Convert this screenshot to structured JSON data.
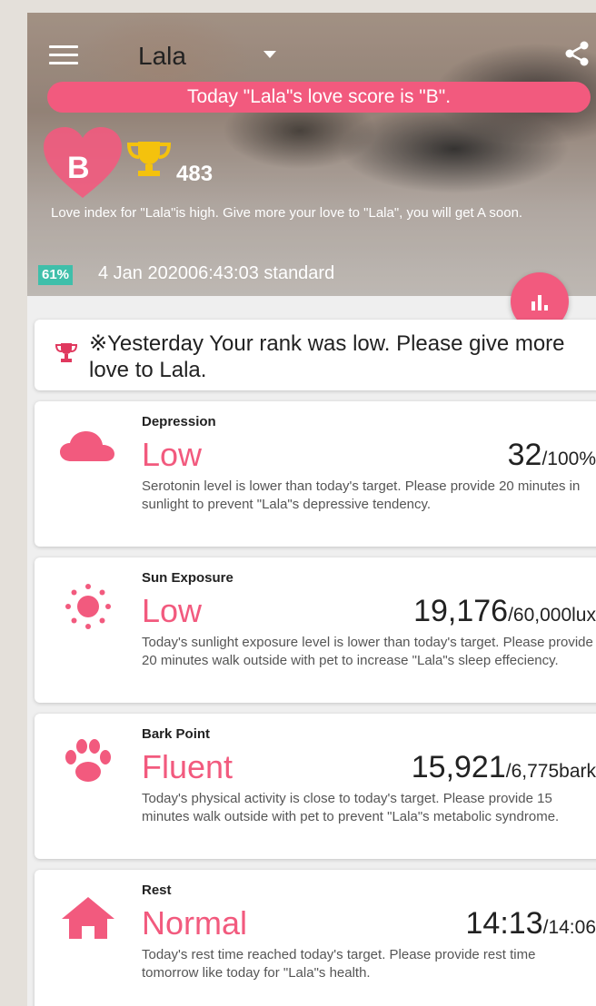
{
  "header": {
    "pet_name": "Lala",
    "score_banner": "Today \"Lala\"s love score is \"B\".",
    "love_grade": "B",
    "trophy_count": "483",
    "love_index_message": "Love index for \"Lala\"is high. Give more your love to \"Lala\", you will get A soon.",
    "battery": "61%",
    "timestamp": "4 Jan 202006:43:03 standard"
  },
  "rank_notice": "※Yesterday Your rank was low. Please give more love to Lala.",
  "metrics": [
    {
      "icon": "cloud-icon",
      "title": "Depression",
      "status": "Low",
      "value": "32",
      "unit": "/100%",
      "description": "Serotonin level is lower than today's target. Please provide 20 minutes in sunlight to prevent \"Lala\"s depressive tendency."
    },
    {
      "icon": "sun-icon",
      "title": "Sun Exposure",
      "status": "Low",
      "value": "19,176",
      "unit": "/60,000lux",
      "description": "Today's sunlight exposure level is lower than today's target. Please provide 20 minutes walk outside with pet to increase \"Lala\"s sleep effeciency."
    },
    {
      "icon": "paw-icon",
      "title": "Bark Point",
      "status": "Fluent",
      "value": "15,921",
      "unit": "/6,775bark",
      "description": "Today's physical activity is close to today's target. Please provide 15 minutes walk outside with pet to prevent \"Lala\"s metabolic syndrome."
    },
    {
      "icon": "home-icon",
      "title": "Rest",
      "status": "Normal",
      "value": "14:13",
      "unit": "/14:06",
      "description": "Today's rest time reached today's target. Please provide rest time tomorrow like today for \"Lala\"s health."
    }
  ],
  "colors": {
    "accent": "#f25a7e",
    "battery": "#3fbfaa",
    "gold": "#f4c20d"
  }
}
